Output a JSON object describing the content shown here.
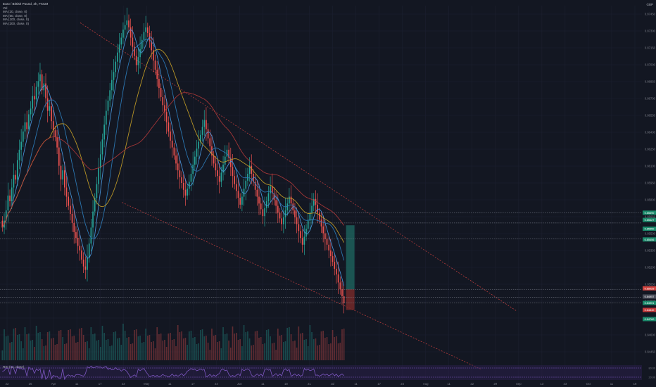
{
  "legend": {
    "symbol": "Euro / British Pound, 4h, FXCM",
    "vol_label": "Vol",
    "ma_lines": [
      "MA (20, close, 0)",
      "MA (50, close, 0)",
      "MA (100, close, 0)",
      "MA (200, close, 0)"
    ]
  },
  "axis_currency": "GBP",
  "rsi_label": "RSI (14, close)",
  "colors": {
    "background": "#131722",
    "up": "#26a69a",
    "down": "#ef5350",
    "ma20": "#4d9be3",
    "ma50": "#2f7fbf",
    "ma100": "#c9a227",
    "ma200": "#b43a3a",
    "channel": "#b53b3b",
    "rsi": "#7e57c2",
    "long_target": "#1f6f66",
    "long_stop": "#7a2a2a"
  },
  "chart_data": {
    "type": "candlestick",
    "symbol": "Euro / British Pound",
    "timeframe": "4h",
    "source": "FXCM",
    "y_ticks": [
      "0.87450",
      "0.87300",
      "0.87150",
      "0.87000",
      "0.86850",
      "0.86700",
      "0.86550",
      "0.86400",
      "0.86250",
      "0.86100",
      "0.85950",
      "0.85800",
      "0.85650",
      "0.85500",
      "0.85350",
      "0.85200",
      "0.85050",
      "0.84900",
      "0.84750",
      "0.84600",
      "0.84450"
    ],
    "ylim": [
      0.844,
      0.875
    ],
    "x_ticks": [
      "22",
      "26",
      "Apr",
      "11",
      "17",
      "23",
      "May",
      "11",
      "17",
      "24",
      "Jun",
      "11",
      "18",
      "21",
      "Jul",
      "11",
      "17",
      "24",
      "Aug",
      "11",
      "22",
      "29",
      "Sep",
      "13",
      "23",
      "Oct",
      "11",
      "18"
    ],
    "closes": [
      0.8556,
      0.8562,
      0.8571,
      0.8584,
      0.8579,
      0.8591,
      0.8602,
      0.8598,
      0.8615,
      0.8624,
      0.8631,
      0.864,
      0.8648,
      0.8642,
      0.8655,
      0.866,
      0.8671,
      0.8668,
      0.8679,
      0.8684,
      0.869,
      0.8676,
      0.8682,
      0.8669,
      0.8658,
      0.8662,
      0.8649,
      0.8641,
      0.8635,
      0.8626,
      0.861,
      0.8598,
      0.8606,
      0.8591,
      0.8583,
      0.8575,
      0.8568,
      0.856,
      0.8552,
      0.8547,
      0.854,
      0.8536,
      0.8528,
      0.8522,
      0.8519,
      0.853,
      0.8542,
      0.8556,
      0.857,
      0.8582,
      0.8594,
      0.8608,
      0.862,
      0.8633,
      0.8646,
      0.8658,
      0.8667,
      0.8676,
      0.8685,
      0.8692,
      0.8701,
      0.8709,
      0.8716,
      0.8722,
      0.8729,
      0.8733,
      0.8737,
      0.8731,
      0.8722,
      0.8714,
      0.8706,
      0.8698,
      0.8705,
      0.8712,
      0.872,
      0.8727,
      0.8731,
      0.8726,
      0.8719,
      0.8711,
      0.8702,
      0.8694,
      0.8686,
      0.8678,
      0.867,
      0.8663,
      0.8657,
      0.8648,
      0.864,
      0.8632,
      0.8626,
      0.8619,
      0.8612,
      0.8606,
      0.86,
      0.8595,
      0.8589,
      0.8584,
      0.859,
      0.8596,
      0.8603,
      0.8611,
      0.8618,
      0.8625,
      0.8631,
      0.8637,
      0.8644,
      0.865,
      0.8642,
      0.8634,
      0.8627,
      0.8619,
      0.8612,
      0.8606,
      0.8601,
      0.8596,
      0.8604,
      0.8611,
      0.8618,
      0.8624,
      0.8617,
      0.8609,
      0.8601,
      0.8594,
      0.8588,
      0.8582,
      0.8576,
      0.8583,
      0.859,
      0.8597,
      0.8603,
      0.861,
      0.8603,
      0.8596,
      0.8589,
      0.8583,
      0.8577,
      0.8572,
      0.8566,
      0.8573,
      0.8579,
      0.8586,
      0.8592,
      0.8586,
      0.858,
      0.8575,
      0.8569,
      0.8564,
      0.8559,
      0.8565,
      0.8571,
      0.8577,
      0.8583,
      0.8577,
      0.8571,
      0.8565,
      0.8559,
      0.8553,
      0.8547,
      0.8541,
      0.8548,
      0.8555,
      0.8562,
      0.8569,
      0.8575,
      0.8581,
      0.8576,
      0.8569,
      0.8563,
      0.8557,
      0.8551,
      0.8546,
      0.8541,
      0.8536,
      0.8531,
      0.8526,
      0.852,
      0.8515,
      0.8508,
      0.8502,
      0.8496,
      0.849
    ],
    "channel_upper": [
      [
        0.125,
        0.8735
      ],
      [
        0.805,
        0.8483
      ]
    ],
    "channel_lower": [
      [
        0.19,
        0.8578
      ],
      [
        0.75,
        0.8432
      ]
    ],
    "position": {
      "entry": 0.8502,
      "target": 0.8558,
      "stop": 0.8484
    },
    "hlines": [
      0.8569,
      0.856,
      0.8546,
      0.8502,
      0.8495,
      0.849
    ],
    "price_labels": [
      {
        "value": "0.85690",
        "kind": "up"
      },
      {
        "value": "0.85627",
        "kind": "up"
      },
      {
        "value": "0.85550",
        "kind": "up"
      },
      {
        "value": "0.85456",
        "kind": "up"
      },
      {
        "value": "0.85029",
        "kind": "last"
      },
      {
        "value": "0.84957",
        "kind": "neutral"
      },
      {
        "value": "0.84901",
        "kind": "up"
      },
      {
        "value": "0.84840",
        "kind": "down"
      },
      {
        "value": "0.84760",
        "kind": "up"
      }
    ],
    "rsi_ticks": [
      "80.00",
      "20.00"
    ]
  }
}
